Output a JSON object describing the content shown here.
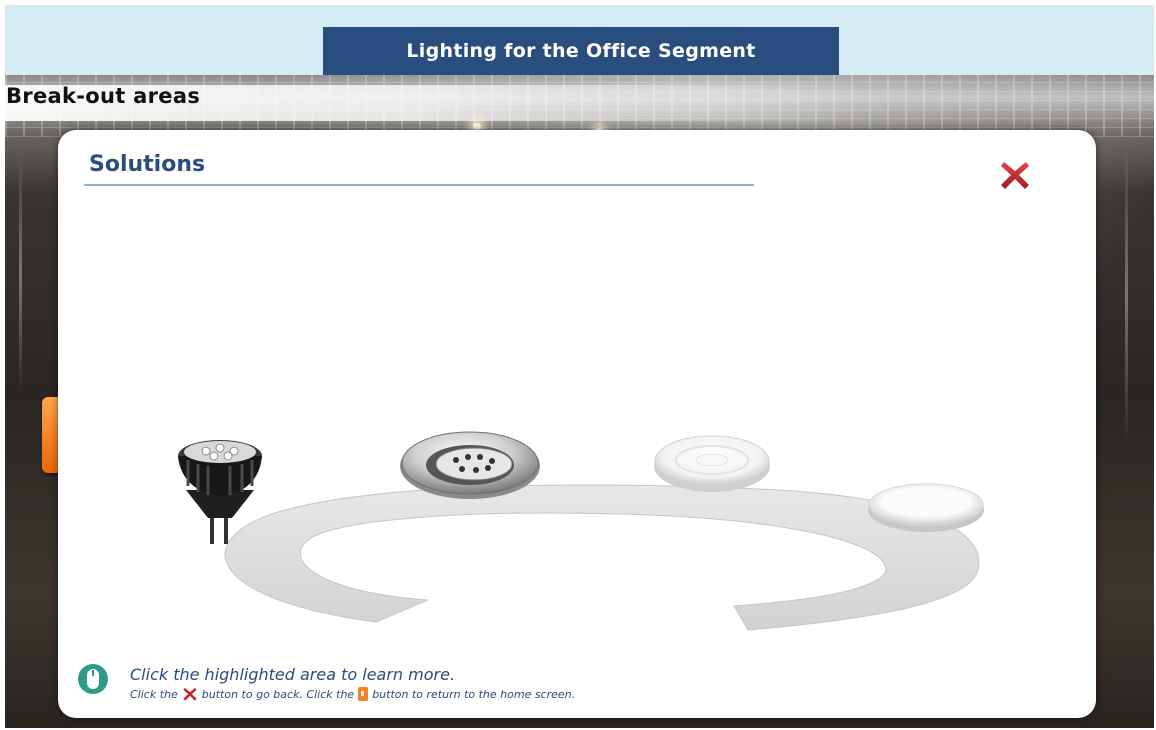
{
  "header": {
    "title": "Lighting for the Office Segment",
    "section": "Break-out areas"
  },
  "panel": {
    "title": "Solutions",
    "close_icon": "close-x-icon",
    "prev_icon": "chevron-left-icon"
  },
  "products": [
    {
      "icon": "mr16-led-spot-lamp-icon"
    },
    {
      "icon": "tiltable-recessed-downlight-icon"
    },
    {
      "icon": "flat-round-downlight-icon"
    },
    {
      "icon": "flat-panel-downlight-icon"
    }
  ],
  "help": {
    "line1": "Click the highlighted area to learn more.",
    "line2_part1": "Click the",
    "line2_part2": "button to go back. Click the",
    "line2_part3": "button to return to the home screen.",
    "mouse_icon": "mouse-icon"
  },
  "colors": {
    "header_bg": "#d5ecf5",
    "title_bar": "#2a4d7f",
    "accent_orange": "#f57d1c",
    "close_red": "#b3232a"
  }
}
